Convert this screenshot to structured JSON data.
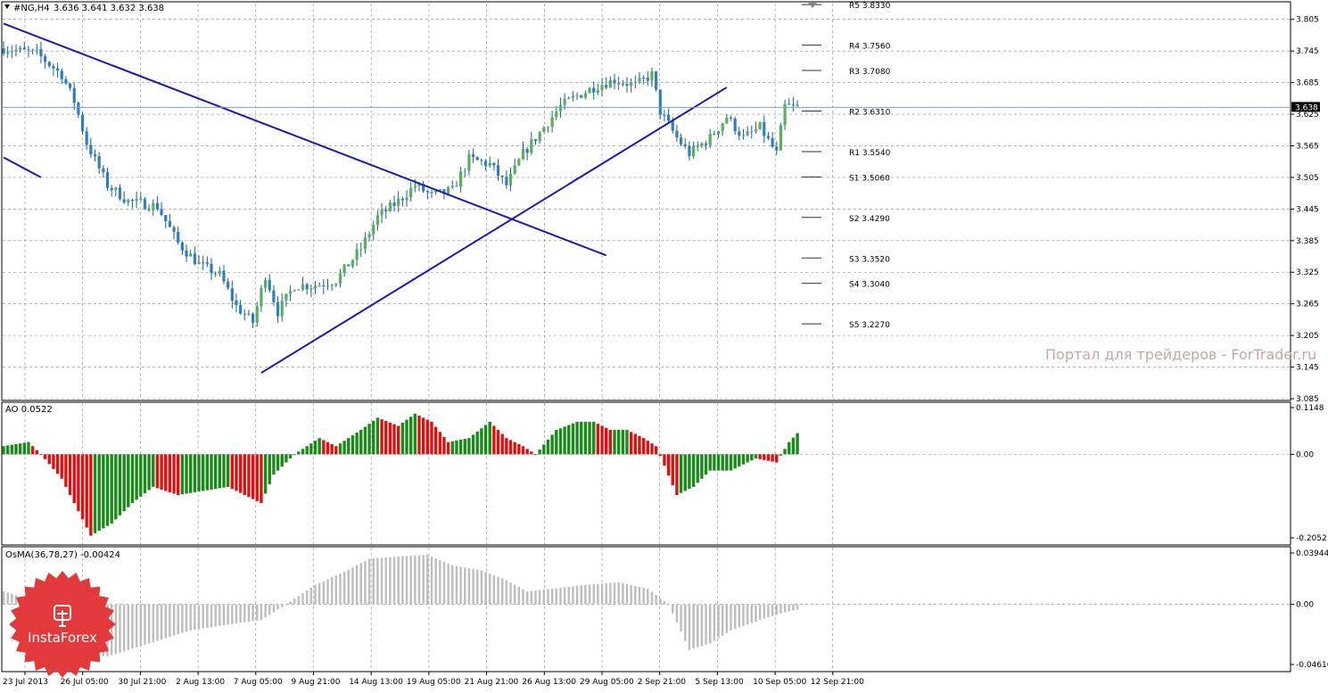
{
  "colors": {
    "background": "#ffffff",
    "grid": "#8a8a8a",
    "bull": "#5ab05a",
    "bear": "#2f7fbf",
    "candle_wick": "#1a5f99",
    "trendline": "#1a1ab3",
    "ao_up": "#1a8a1a",
    "ao_down": "#e01010",
    "osma": "#bdbdbd",
    "pivot": "#333333",
    "watermark": "#c8a6a6",
    "logo": "#e23a3a"
  },
  "header": {
    "symbol_label": "#NG,H4",
    "ohlc": "3.636 3.641 3.632 3.638"
  },
  "watermark": "Портал для трейдеров - ForTrader.ru",
  "logo": {
    "name": "InstaForex"
  },
  "chart_data": [
    {
      "type": "candlestick",
      "title": "#NG,H4",
      "ylim": [
        3.085,
        3.835
      ],
      "y_ticks": [
        "3.805",
        "3.745",
        "3.685",
        "3.625",
        "3.565",
        "3.505",
        "3.445",
        "3.385",
        "3.325",
        "3.265",
        "3.205",
        "3.145",
        "3.085"
      ],
      "x_ticks": [
        "23 Jul 2013",
        "26 Jul 05:00",
        "30 Jul 21:00",
        "2 Aug 13:00",
        "7 Aug 05:00",
        "9 Aug 21:00",
        "14 Aug 13:00",
        "19 Aug 05:00",
        "21 Aug 21:00",
        "26 Aug 13:00",
        "29 Aug 05:00",
        "2 Sep 21:00",
        "5 Sep 13:00",
        "10 Sep 05:00",
        "12 Sep 21:00"
      ],
      "current_price": "3.638",
      "close_path": [
        [
          0,
          3.75
        ],
        [
          8,
          3.74
        ],
        [
          14,
          3.7
        ],
        [
          17,
          3.65
        ],
        [
          20,
          3.57
        ],
        [
          25,
          3.49
        ],
        [
          30,
          3.46
        ],
        [
          37,
          3.45
        ],
        [
          42,
          3.38
        ],
        [
          47,
          3.34
        ],
        [
          52,
          3.32
        ],
        [
          56,
          3.26
        ],
        [
          60,
          3.23
        ],
        [
          63,
          3.32
        ],
        [
          66,
          3.25
        ],
        [
          70,
          3.3
        ],
        [
          75,
          3.3
        ],
        [
          80,
          3.31
        ],
        [
          86,
          3.37
        ],
        [
          90,
          3.43
        ],
        [
          95,
          3.46
        ],
        [
          99,
          3.49
        ],
        [
          103,
          3.47
        ],
        [
          108,
          3.48
        ],
        [
          112,
          3.54
        ],
        [
          117,
          3.53
        ],
        [
          121,
          3.49
        ],
        [
          125,
          3.55
        ],
        [
          130,
          3.6
        ],
        [
          134,
          3.64
        ],
        [
          138,
          3.66
        ],
        [
          143,
          3.68
        ],
        [
          147,
          3.69
        ],
        [
          152,
          3.68
        ],
        [
          156,
          3.7
        ],
        [
          158,
          3.63
        ],
        [
          162,
          3.58
        ],
        [
          165,
          3.55
        ],
        [
          170,
          3.58
        ],
        [
          174,
          3.62
        ],
        [
          178,
          3.58
        ],
        [
          182,
          3.6
        ],
        [
          186,
          3.55
        ],
        [
          188,
          3.64
        ],
        [
          191,
          3.638
        ]
      ],
      "trendlines": [
        {
          "from": [
            0,
            3.797
          ],
          "to": [
            145,
            3.357
          ]
        },
        {
          "from": [
            0,
            3.543
          ],
          "to": [
            9,
            3.505
          ]
        },
        {
          "from": [
            62,
            3.134
          ],
          "to": [
            174,
            3.676
          ]
        }
      ],
      "pivots": [
        {
          "label": "R5",
          "value": "3.8330"
        },
        {
          "label": "R4",
          "value": "3.7560"
        },
        {
          "label": "R3",
          "value": "3.7080"
        },
        {
          "label": "R2",
          "value": "3.6310"
        },
        {
          "label": "R1",
          "value": "3.5540"
        },
        {
          "label": "S1",
          "value": "3.5060"
        },
        {
          "label": "S2",
          "value": "3.4290"
        },
        {
          "label": "S3",
          "value": "3.3520"
        },
        {
          "label": "S4",
          "value": "3.3040"
        },
        {
          "label": "S5",
          "value": "3.2270"
        }
      ]
    },
    {
      "type": "bar",
      "title": "AO 0.0522",
      "ylim": [
        -0.2052,
        0.1148
      ],
      "y_ticks": [
        "0.1148",
        "0.00",
        "-0.2052"
      ],
      "values_path": [
        [
          0,
          0.02
        ],
        [
          6,
          0.03
        ],
        [
          9,
          0.0
        ],
        [
          14,
          -0.06
        ],
        [
          18,
          -0.14
        ],
        [
          21,
          -0.2
        ],
        [
          26,
          -0.17
        ],
        [
          31,
          -0.12
        ],
        [
          36,
          -0.08
        ],
        [
          42,
          -0.1
        ],
        [
          48,
          -0.09
        ],
        [
          54,
          -0.08
        ],
        [
          58,
          -0.1
        ],
        [
          62,
          -0.12
        ],
        [
          65,
          -0.05
        ],
        [
          70,
          0.0
        ],
        [
          76,
          0.04
        ],
        [
          80,
          0.02
        ],
        [
          86,
          0.06
        ],
        [
          90,
          0.09
        ],
        [
          95,
          0.07
        ],
        [
          99,
          0.1
        ],
        [
          103,
          0.08
        ],
        [
          107,
          0.03
        ],
        [
          112,
          0.04
        ],
        [
          117,
          0.08
        ],
        [
          121,
          0.04
        ],
        [
          125,
          0.02
        ],
        [
          128,
          0.0
        ],
        [
          133,
          0.06
        ],
        [
          138,
          0.08
        ],
        [
          142,
          0.08
        ],
        [
          146,
          0.06
        ],
        [
          150,
          0.06
        ],
        [
          154,
          0.04
        ],
        [
          157,
          0.02
        ],
        [
          162,
          -0.1
        ],
        [
          166,
          -0.08
        ],
        [
          170,
          -0.04
        ],
        [
          175,
          -0.04
        ],
        [
          181,
          -0.01
        ],
        [
          186,
          -0.02
        ],
        [
          189,
          0.03
        ],
        [
          191,
          0.052
        ]
      ]
    },
    {
      "type": "histogram",
      "title": "OsMA(36,78,27) -0.00424",
      "ylim": [
        -0.04616,
        0.03944
      ],
      "y_ticks": [
        "0.03944",
        "0.00",
        "-0.04616"
      ],
      "values_path": [
        [
          0,
          0.01
        ],
        [
          5,
          0.005
        ],
        [
          10,
          -0.01
        ],
        [
          20,
          -0.04
        ],
        [
          25,
          -0.04
        ],
        [
          35,
          -0.03
        ],
        [
          45,
          -0.02
        ],
        [
          55,
          -0.015
        ],
        [
          62,
          -0.012
        ],
        [
          68,
          0.0
        ],
        [
          75,
          0.015
        ],
        [
          82,
          0.025
        ],
        [
          88,
          0.035
        ],
        [
          96,
          0.037
        ],
        [
          102,
          0.038
        ],
        [
          108,
          0.03
        ],
        [
          115,
          0.026
        ],
        [
          120,
          0.02
        ],
        [
          126,
          0.01
        ],
        [
          132,
          0.012
        ],
        [
          140,
          0.015
        ],
        [
          148,
          0.017
        ],
        [
          155,
          0.012
        ],
        [
          160,
          0.0
        ],
        [
          165,
          -0.035
        ],
        [
          170,
          -0.03
        ],
        [
          175,
          -0.02
        ],
        [
          182,
          -0.012
        ],
        [
          188,
          -0.006
        ],
        [
          191,
          -0.004
        ]
      ]
    }
  ]
}
